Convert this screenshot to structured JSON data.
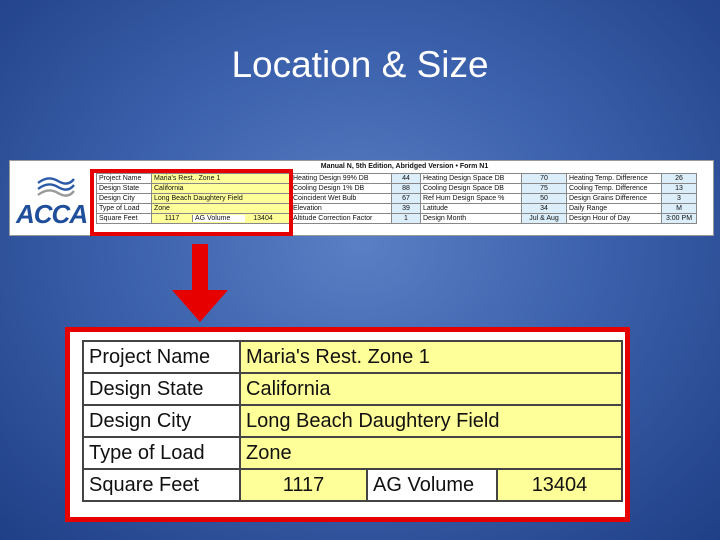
{
  "slide": {
    "title": "Location & Size"
  },
  "logo": {
    "text": "ACCA"
  },
  "strip": {
    "header": "Manual N, 5th Edition, Abridged Version  •  Form N1",
    "rows": [
      [
        "Project Name",
        "Maria's Rest.. Zone 1",
        "Heating Design 99% DB",
        "44",
        "Heating Design Space DB",
        "70",
        "Heating Temp. Difference",
        "26"
      ],
      [
        "Design State",
        "California",
        "Cooling Design 1% DB",
        "88",
        "Cooling Design Space DB",
        "75",
        "Cooling Temp. Difference",
        "13"
      ],
      [
        "Design City",
        "Long Beach Daughtery Field",
        "Coincident Wet Bulb",
        "67",
        "Ref Hum Design Space %",
        "50",
        "Design Grains Difference",
        "3"
      ],
      [
        "Type of Load",
        "Zone",
        "Elevation",
        "39",
        "Latitude",
        "34",
        "Daily Range",
        "M"
      ],
      [
        "Square Feet",
        "1117",
        "AG Volume",
        "13404",
        "Altitude Correction Factor",
        "1",
        "Design Month",
        "Jul & Aug",
        "Design Hour of Day",
        "3:00 PM"
      ]
    ]
  },
  "zoom": {
    "rows": [
      {
        "label": "Project Name",
        "value": "Maria's Rest. Zone 1"
      },
      {
        "label": "Design State",
        "value": "California"
      },
      {
        "label": "Design City",
        "value": "Long Beach Daughtery Field"
      },
      {
        "label": "Type of Load",
        "value": "Zone"
      }
    ],
    "square_feet": {
      "label": "Square Feet",
      "value": "1117",
      "ag_label": "AG Volume",
      "ag_value": "13404"
    }
  },
  "colors": {
    "highlight": "#e60000",
    "cell_fill": "#ffff99",
    "background": "#3d62ad"
  }
}
